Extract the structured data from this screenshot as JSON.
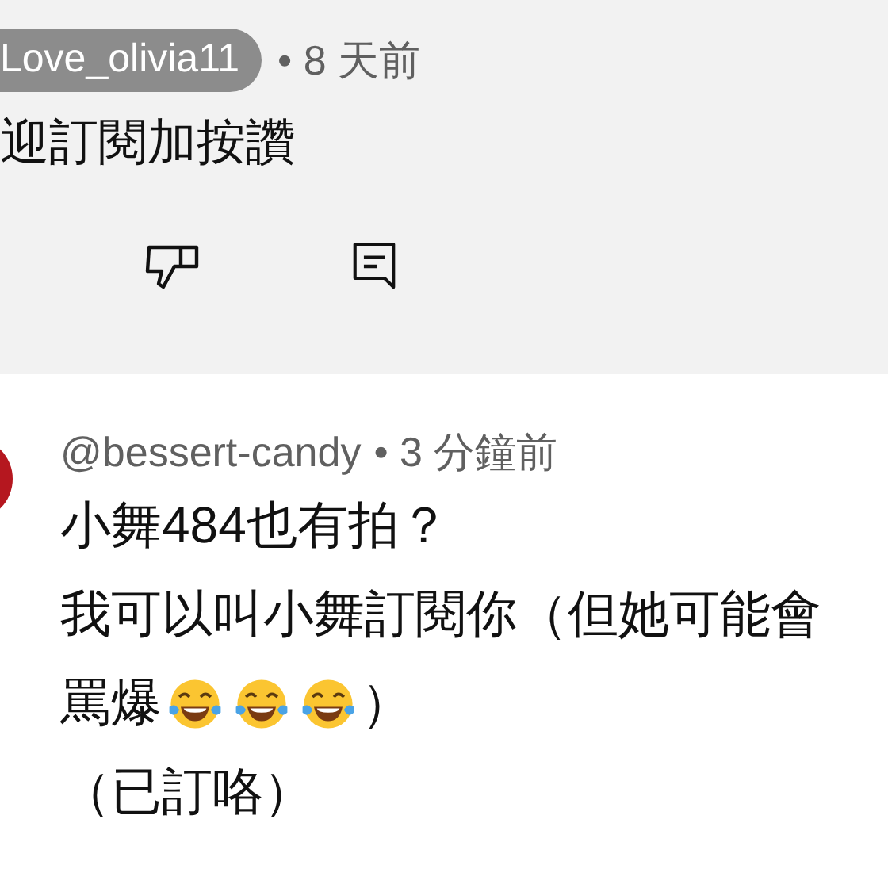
{
  "previous_comment": {
    "author": "Love_olivia11",
    "time": "• 8 天前",
    "text": "迎訂閱加按讚"
  },
  "comment": {
    "author": "@bessert-candy",
    "time": "• 3 分鐘前",
    "lines": [
      {
        "parts": [
          {
            "kind": "text",
            "text": "小舞484也有拍？"
          }
        ]
      },
      {
        "parts": [
          {
            "kind": "text",
            "text": "我可以叫小舞訂閱你（但她可能會"
          }
        ]
      },
      {
        "parts": [
          {
            "kind": "text",
            "text": "罵爆"
          },
          {
            "kind": "emoji"
          },
          {
            "kind": "emoji"
          },
          {
            "kind": "emoji"
          },
          {
            "kind": "text",
            "text": "）"
          }
        ]
      },
      {
        "parts": [
          {
            "kind": "text",
            "text": "（已訂咯）"
          }
        ]
      }
    ]
  }
}
